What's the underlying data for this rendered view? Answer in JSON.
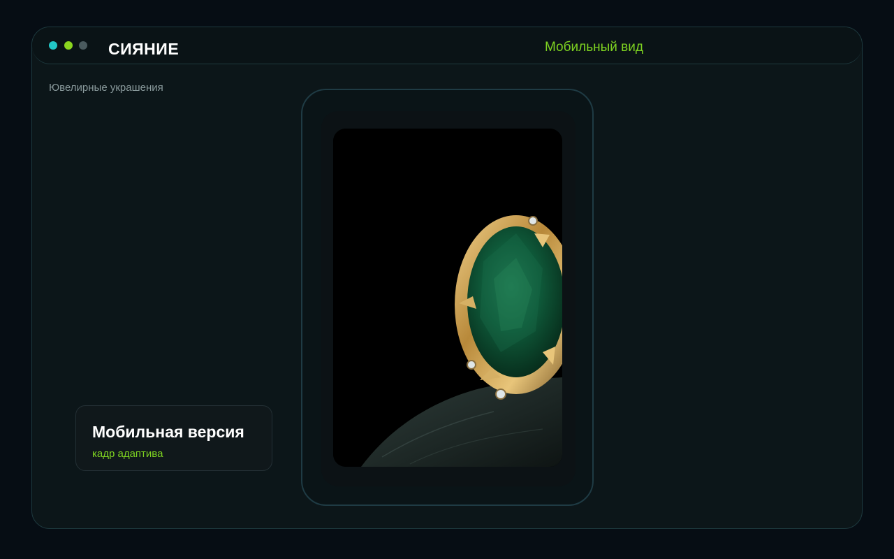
{
  "window": {
    "title": "СИЯНИЕ",
    "view_label": "Мобильный вид",
    "controls": [
      {
        "name": "cyan-dot",
        "color": "#22c7c7"
      },
      {
        "name": "lime-dot",
        "color": "#8bd61f"
      },
      {
        "name": "gray-dot",
        "color": "#4a5a5e"
      }
    ]
  },
  "sidebar": {
    "category": "Ювелирные украшения"
  },
  "info_card": {
    "title": "Мобильная версия",
    "subtitle": "кадр адаптива"
  },
  "device": {
    "screen_content": "emerald-ring-photo"
  },
  "colors": {
    "accent": "#7ed321",
    "background": "#060d14",
    "panel": "#0c1619",
    "border": "#1e3a3f",
    "gold": "#b8893a",
    "emerald": "#0f5a3a"
  }
}
